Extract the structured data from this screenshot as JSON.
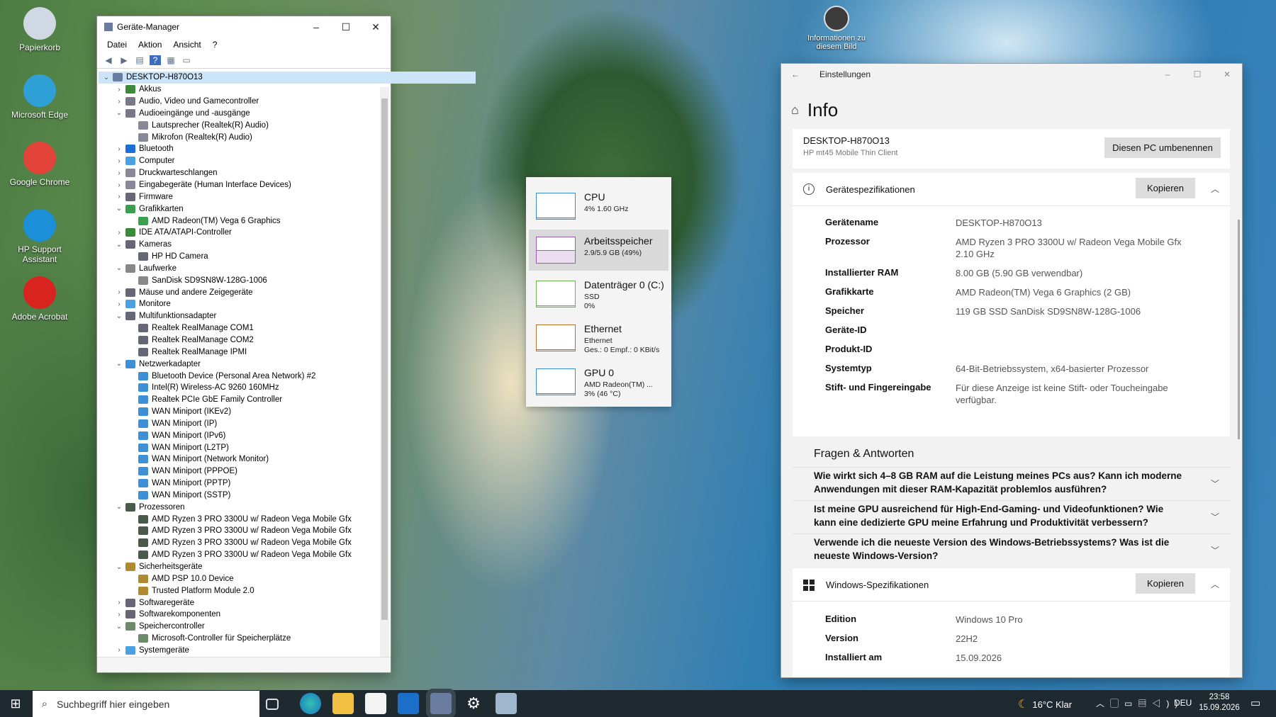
{
  "desktop": {
    "icons": [
      {
        "label": "Papierkorb",
        "color": "#cfd8e3"
      },
      {
        "label": "Microsoft Edge",
        "color": "#2fa0d6"
      },
      {
        "label": "Google Chrome",
        "color": "#e2443a"
      },
      {
        "label": "HP Support Assistant",
        "color": "#1b8fd8"
      },
      {
        "label": "Adobe Acrobat",
        "color": "#d8231f"
      }
    ],
    "info_icon_label": "Informationen zu diesem Bild"
  },
  "device_manager": {
    "title": "Geräte-Manager",
    "controls": [
      "–",
      "☐",
      "✕"
    ],
    "menu": [
      "Datei",
      "Aktion",
      "Ansicht",
      "?"
    ],
    "tree": [
      {
        "l": 0,
        "e": "v",
        "t": "DESKTOP-H870O13",
        "c": "#6a7ca0"
      },
      {
        "l": 1,
        "e": ">",
        "t": "Akkus",
        "c": "#3a8a3a"
      },
      {
        "l": 1,
        "e": ">",
        "t": "Audio, Video und Gamecontroller",
        "c": "#778"
      },
      {
        "l": 1,
        "e": "v",
        "t": "Audioeingänge und -ausgänge",
        "c": "#778"
      },
      {
        "l": 2,
        "e": "",
        "t": "Lautsprecher (Realtek(R) Audio)",
        "c": "#889"
      },
      {
        "l": 2,
        "e": "",
        "t": "Mikrofon (Realtek(R) Audio)",
        "c": "#889"
      },
      {
        "l": 1,
        "e": ">",
        "t": "Bluetooth",
        "c": "#1d6fd6"
      },
      {
        "l": 1,
        "e": ">",
        "t": "Computer",
        "c": "#4aa0e0"
      },
      {
        "l": 1,
        "e": ">",
        "t": "Druckwarteschlangen",
        "c": "#889"
      },
      {
        "l": 1,
        "e": ">",
        "t": "Eingabegeräte (Human Interface Devices)",
        "c": "#889"
      },
      {
        "l": 1,
        "e": ">",
        "t": "Firmware",
        "c": "#667"
      },
      {
        "l": 1,
        "e": "v",
        "t": "Grafikkarten",
        "c": "#3aa050"
      },
      {
        "l": 2,
        "e": "",
        "t": "AMD Radeon(TM) Vega 6 Graphics",
        "c": "#3aa050"
      },
      {
        "l": 1,
        "e": ">",
        "t": "IDE ATA/ATAPI-Controller",
        "c": "#3a8a3a"
      },
      {
        "l": 1,
        "e": "v",
        "t": "Kameras",
        "c": "#667"
      },
      {
        "l": 2,
        "e": "",
        "t": "HP HD Camera",
        "c": "#667"
      },
      {
        "l": 1,
        "e": "v",
        "t": "Laufwerke",
        "c": "#888"
      },
      {
        "l": 2,
        "e": "",
        "t": "SanDisk SD9SN8W-128G-1006",
        "c": "#888"
      },
      {
        "l": 1,
        "e": ">",
        "t": "Mäuse und andere Zeigegeräte",
        "c": "#667"
      },
      {
        "l": 1,
        "e": ">",
        "t": "Monitore",
        "c": "#4aa0e0"
      },
      {
        "l": 1,
        "e": "v",
        "t": "Multifunktionsadapter",
        "c": "#667"
      },
      {
        "l": 2,
        "e": "",
        "t": "Realtek RealManage COM1",
        "c": "#667"
      },
      {
        "l": 2,
        "e": "",
        "t": "Realtek RealManage COM2",
        "c": "#667"
      },
      {
        "l": 2,
        "e": "",
        "t": "Realtek RealManage IPMI",
        "c": "#667"
      },
      {
        "l": 1,
        "e": "v",
        "t": "Netzwerkadapter",
        "c": "#3d8fd6"
      },
      {
        "l": 2,
        "e": "",
        "t": "Bluetooth Device (Personal Area Network) #2",
        "c": "#3d8fd6"
      },
      {
        "l": 2,
        "e": "",
        "t": "Intel(R) Wireless-AC 9260 160MHz",
        "c": "#3d8fd6"
      },
      {
        "l": 2,
        "e": "",
        "t": "Realtek PCIe GbE Family Controller",
        "c": "#3d8fd6"
      },
      {
        "l": 2,
        "e": "",
        "t": "WAN Miniport (IKEv2)",
        "c": "#3d8fd6"
      },
      {
        "l": 2,
        "e": "",
        "t": "WAN Miniport (IP)",
        "c": "#3d8fd6"
      },
      {
        "l": 2,
        "e": "",
        "t": "WAN Miniport (IPv6)",
        "c": "#3d8fd6"
      },
      {
        "l": 2,
        "e": "",
        "t": "WAN Miniport (L2TP)",
        "c": "#3d8fd6"
      },
      {
        "l": 2,
        "e": "",
        "t": "WAN Miniport (Network Monitor)",
        "c": "#3d8fd6"
      },
      {
        "l": 2,
        "e": "",
        "t": "WAN Miniport (PPPOE)",
        "c": "#3d8fd6"
      },
      {
        "l": 2,
        "e": "",
        "t": "WAN Miniport (PPTP)",
        "c": "#3d8fd6"
      },
      {
        "l": 2,
        "e": "",
        "t": "WAN Miniport (SSTP)",
        "c": "#3d8fd6"
      },
      {
        "l": 1,
        "e": "v",
        "t": "Prozessoren",
        "c": "#4a5a4a"
      },
      {
        "l": 2,
        "e": "",
        "t": "AMD Ryzen 3 PRO 3300U w/ Radeon Vega Mobile Gfx",
        "c": "#4a5a4a"
      },
      {
        "l": 2,
        "e": "",
        "t": "AMD Ryzen 3 PRO 3300U w/ Radeon Vega Mobile Gfx",
        "c": "#4a5a4a"
      },
      {
        "l": 2,
        "e": "",
        "t": "AMD Ryzen 3 PRO 3300U w/ Radeon Vega Mobile Gfx",
        "c": "#4a5a4a"
      },
      {
        "l": 2,
        "e": "",
        "t": "AMD Ryzen 3 PRO 3300U w/ Radeon Vega Mobile Gfx",
        "c": "#4a5a4a"
      },
      {
        "l": 1,
        "e": "v",
        "t": "Sicherheitsgeräte",
        "c": "#b08a30"
      },
      {
        "l": 2,
        "e": "",
        "t": "AMD PSP 10.0 Device",
        "c": "#b08a30"
      },
      {
        "l": 2,
        "e": "",
        "t": "Trusted Platform Module 2.0",
        "c": "#b08a30"
      },
      {
        "l": 1,
        "e": ">",
        "t": "Softwaregeräte",
        "c": "#667"
      },
      {
        "l": 1,
        "e": ">",
        "t": "Softwarekomponenten",
        "c": "#667"
      },
      {
        "l": 1,
        "e": "v",
        "t": "Speichercontroller",
        "c": "#6a8a6a"
      },
      {
        "l": 2,
        "e": "",
        "t": "Microsoft-Controller für Speicherplätze",
        "c": "#6a8a6a"
      },
      {
        "l": 1,
        "e": ">",
        "t": "Systemgeräte",
        "c": "#4aa0e0"
      }
    ]
  },
  "task_popup": {
    "items": [
      {
        "title": "CPU",
        "l1": "4%  1.60 GHz",
        "l2": "",
        "l3": "",
        "color": "#3b8fd0",
        "value": 0.04
      },
      {
        "title": "Arbeitsspeicher",
        "l1": "2.9/5.9 GB (49%)",
        "l2": "",
        "l3": "",
        "color": "#9d5ab8",
        "value": 0.49
      },
      {
        "title": "Datenträger 0 (C:)",
        "l1": "SSD",
        "l2": "0%",
        "l3": "",
        "color": "#6bb04a",
        "value": 0
      },
      {
        "title": "Ethernet",
        "l1": "Ethernet",
        "l2": "Ges.: 0 Empf.: 0 KBit/s",
        "l3": "",
        "color": "#b8722c",
        "value": 0
      },
      {
        "title": "GPU 0",
        "l1": "AMD Radeon(TM) ...",
        "l2": "3% (46 °C)",
        "l3": "",
        "color": "#3b8fd0",
        "value": 0.03
      }
    ]
  },
  "settings": {
    "window_title": "Einstellungen",
    "page_title": "Info",
    "pc_name": "DESKTOP-H870O13",
    "pc_model": "HP mt45 Mobile Thin Client",
    "rename_button": "Diesen PC umbenennen",
    "device_spec_header": "Gerätespezifikationen",
    "copy_button": "Kopieren",
    "specs": [
      {
        "k": "Gerätename",
        "v": "DESKTOP-H870O13"
      },
      {
        "k": "Prozessor",
        "v": "AMD Ryzen 3 PRO 3300U w/ Radeon Vega Mobile Gfx 2.10 GHz"
      },
      {
        "k": "Installierter RAM",
        "v": "8.00 GB (5.90 GB verwendbar)"
      },
      {
        "k": "Grafikkarte",
        "v": "AMD Radeon(TM) Vega 6 Graphics (2 GB)"
      },
      {
        "k": "Speicher",
        "v": "119 GB SSD SanDisk SD9SN8W-128G-1006"
      },
      {
        "k": "Geräte-ID",
        "v": ""
      },
      {
        "k": "Produkt-ID",
        "v": ""
      },
      {
        "k": "Systemtyp",
        "v": "64-Bit-Betriebssystem, x64-basierter Prozessor"
      },
      {
        "k": "Stift- und Fingereingabe",
        "v": "Für diese Anzeige ist keine Stift- oder Toucheingabe verfügbar."
      }
    ],
    "faq_header": "Fragen & Antworten",
    "faqs": [
      "Wie wirkt sich 4–8 GB RAM auf die Leistung meines PCs aus? Kann ich moderne Anwendungen mit dieser RAM-Kapazität problemlos ausführen?",
      "Ist meine GPU ausreichend für High-End-Gaming- und Videofunktionen? Wie kann eine dedizierte GPU meine Erfahrung und Produktivität verbessern?",
      "Verwende ich die neueste Version des Windows-Betriebssystems? Was ist die neueste Windows-Version?"
    ],
    "win_spec_header": "Windows-Spezifikationen",
    "win_specs": [
      {
        "k": "Edition",
        "v": "Windows 10 Pro"
      },
      {
        "k": "Version",
        "v": "22H2"
      },
      {
        "k": "Installiert am",
        "v": "15.09.2026"
      }
    ]
  },
  "taskbar": {
    "search_placeholder": "Suchbegriff hier eingeben",
    "weather": "16°C  Klar",
    "lang": "DEU",
    "time": "23:58",
    "date": "15.09.2026"
  }
}
